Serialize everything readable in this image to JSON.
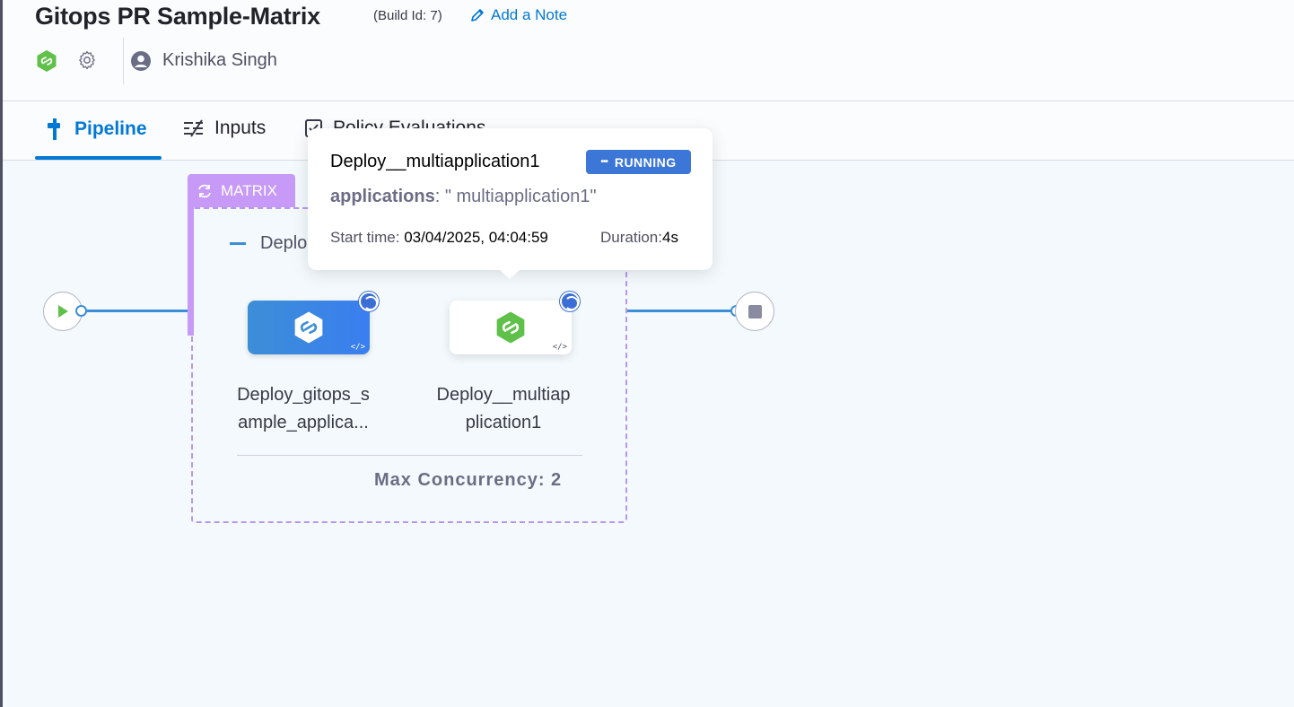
{
  "header": {
    "title": "Gitops PR Sample-Matrix",
    "build_id": "(Build Id: 7)",
    "add_note": "Add a Note",
    "user_name": "Krishika Singh"
  },
  "tabs": [
    {
      "label": "Pipeline",
      "icon": "pipeline-icon",
      "active": true
    },
    {
      "label": "Inputs",
      "icon": "inputs-icon",
      "active": false
    },
    {
      "label": "Policy Evaluations",
      "icon": "policy-check-icon",
      "active": false
    }
  ],
  "matrix": {
    "tag": "MATRIX",
    "stage_label": "Deplo",
    "max_concurrency": "Max Concurrency: 2",
    "steps": [
      {
        "name_line1": "Deploy_gitops_s",
        "name_line2": "ample_applica...",
        "status": "running"
      },
      {
        "name_line1": "Deploy__multiap",
        "name_line2": "plication1",
        "status": "running"
      }
    ]
  },
  "tooltip": {
    "title": "Deploy__multiapplication1",
    "status": "RUNNING",
    "apps_key": "applications",
    "apps_value": ": \" multiapplication1\"",
    "start_label": "Start time: ",
    "start_value": "03/04/2025, 04:04:59",
    "duration_label": "Duration:",
    "duration_value": "4s"
  },
  "colors": {
    "accent": "#0278d5",
    "matrix": "#c69af6",
    "running": "#3c76d6",
    "gitops_green": "#5fc04a"
  }
}
